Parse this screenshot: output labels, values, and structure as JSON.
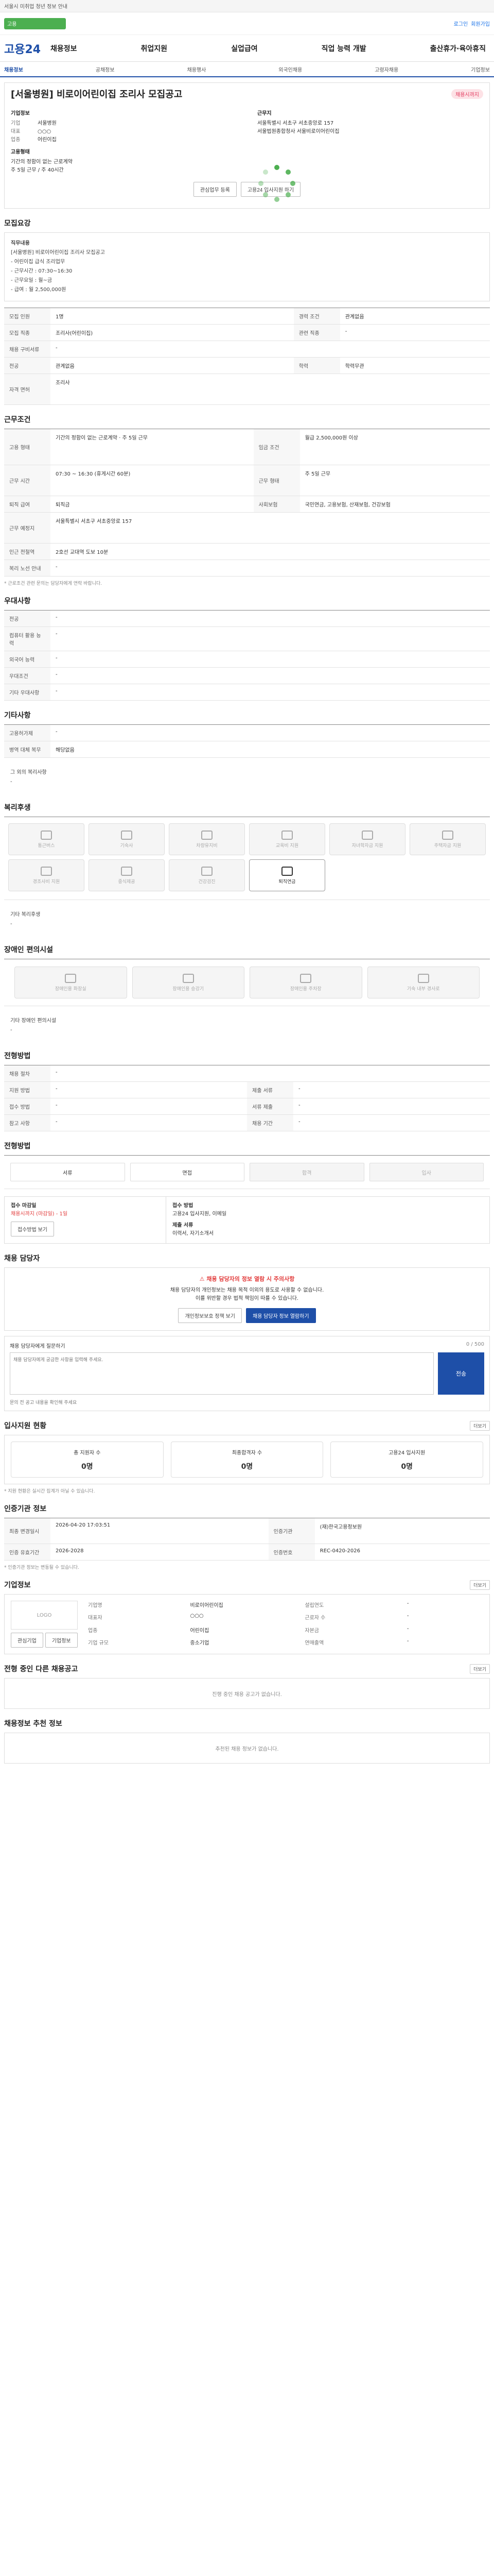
{
  "topbar": {
    "notice": "서울시 미취업 청년 정보 안내"
  },
  "gnb_top": {
    "badge": "고용",
    "links": [
      "로그인",
      "회원가입"
    ]
  },
  "logo": "고용24",
  "menu": [
    "채용정보",
    "취업지원",
    "실업급여",
    "직업 능력 개발",
    "출산휴가·육아휴직"
  ],
  "lnb": [
    "채용정보",
    "공채정보",
    "채용행사",
    "외국인채용",
    "고령자채용",
    "기업정보"
  ],
  "job": {
    "title": "[서울병원] 비로이어린이집 조리사 모집공고",
    "badge": "채용시까지",
    "company_h": "기업정보",
    "company_name": "서울병원",
    "ceo_label": "대표",
    "ceo": "○○○",
    "industry_label": "업종",
    "industry": "어린이집",
    "cond_h": "고용형태",
    "cond1": "기간의 정함이 없는 근로계약",
    "cond2": "주 5일 근무 / 주 40시간",
    "right_h": "근무지",
    "right1": "서울특별시 서초구 서초중앙로 157",
    "right2": "서울법원종합청사 서울비로이어린이집",
    "fav_btn": "관심업무 등록",
    "apply_btn": "고용24 입사지원 하기"
  },
  "recruit": {
    "h": "모집요강",
    "lines": [
      "직무내용",
      "[서울병원] 비로이어린이집 조리사 모집공고",
      "- 어린이집 급식 조리업무",
      "- 근무시간 : 07:30~16:30",
      "- 근무요일 : 월~금",
      "- 급여 : 월 2,500,000원"
    ],
    "table": [
      [
        "모집 인원",
        "1명",
        "경력 조건",
        "관계없음"
      ],
      [
        "모집 직종",
        "조리사(어린이집)",
        "관련 직종",
        "-"
      ],
      [
        "채용 구비서류",
        "-",
        "",
        ""
      ],
      [
        "전공",
        "관계없음",
        "학력",
        "학력무관"
      ],
      [
        "자격 면허",
        "조리사",
        "",
        ""
      ]
    ]
  },
  "work": {
    "h": "근무조건",
    "table": [
      [
        "고용 형태",
        "기간의 정함이 없는 근로계약 · 주 5일 근무",
        "임금 조건",
        "월급 2,500,000원 이상"
      ],
      [
        "근무 시간",
        "07:30 ~ 16:30 (휴게시간 60분)",
        "근무 형태",
        "주 5일 근무"
      ],
      [
        "퇴직 급여",
        "퇴직금",
        "사회보험",
        "국민연금, 고용보험, 산재보험, 건강보험"
      ],
      [
        "근무 예정지",
        "서울특별시 서초구 서초중앙로 157",
        "",
        ""
      ],
      [
        "인근 전철역",
        "2호선 교대역 도보 10분",
        "",
        ""
      ],
      [
        "복리 노선 안내",
        "-",
        "",
        ""
      ]
    ],
    "note": "* 근로조건 관련 문의는 담당자에게 연락 바랍니다."
  },
  "other": {
    "h": "우대사항",
    "rows": [
      [
        "전공",
        "-"
      ],
      [
        "컴퓨터 활용 능력",
        "-"
      ],
      [
        "외국어 능력",
        "-"
      ],
      [
        "우대조건",
        "-"
      ],
      [
        "기타 우대사항",
        "-"
      ]
    ]
  },
  "etc": {
    "h": "기타사항",
    "rows": [
      [
        "고용허가제",
        "-"
      ],
      [
        "병역 대체 복무",
        "해당없음"
      ]
    ],
    "extra_h": "그 외의 복리사항",
    "extra": "-"
  },
  "welfare": {
    "h": "복리후생",
    "items": [
      {
        "l": "통근버스",
        "on": false
      },
      {
        "l": "기숙사",
        "on": false
      },
      {
        "l": "차량유지비",
        "on": false
      },
      {
        "l": "교육비 지원",
        "on": false
      },
      {
        "l": "자녀학자금 지원",
        "on": false
      },
      {
        "l": "주택자금 지원",
        "on": false
      },
      {
        "l": "경조사비 지원",
        "on": false
      },
      {
        "l": "중식제공",
        "on": false
      },
      {
        "l": "건강검진",
        "on": false
      },
      {
        "l": "퇴직연금",
        "on": true
      }
    ],
    "extra_h": "기타 복리후생",
    "extra": "-"
  },
  "disability": {
    "h": "장애인 편의시설",
    "items": [
      "장애인용 화장실",
      "장애인용 승강기",
      "장애인용 주차장",
      "기숙 내부 경사로"
    ],
    "extra_h": "기타 장애인 편의시설",
    "extra": "-"
  },
  "apply": {
    "h": "전형방법",
    "rows": [
      [
        "채용 절차",
        "-",
        "",
        ""
      ],
      [
        "지원 방법",
        "-",
        "제출 서류",
        "-"
      ],
      [
        "접수 방법",
        "-",
        "서류 제출",
        "-"
      ],
      [
        "참고 사항",
        "-",
        "채용 기간",
        "-"
      ]
    ]
  },
  "process": {
    "h": "전형방법",
    "steps": [
      "서류",
      "면접",
      "합격",
      "입사"
    ],
    "dis": [
      false,
      false,
      true,
      true
    ]
  },
  "receipt": {
    "left1": "접수 마감일",
    "left2": "채용시까지 (마감일) - 1일",
    "left_btn": "접수방법 보기",
    "right1": "접수 방법",
    "right2": "고용24 입사지원, 이메일",
    "right3": "제출 서류",
    "right4": "이력서, 자기소개서"
  },
  "manager": {
    "h": "채용 담당자",
    "t": "채용 담당자의 정보 열람 시 주의사항",
    "d1": "채용 담당자의 개인정보는 채용 목적 이외의 용도로 사용할 수 없습니다.",
    "d2": "이를 위반할 경우 법적 책임이 따를 수 있습니다.",
    "btn1": "개인정보보호 정책 보기",
    "btn2": "채용 담당자 정보 열람하기"
  },
  "question": {
    "label": "채용 담당자에게 질문하기",
    "count": "0 / 500",
    "placeholder": "채용 담당자에게 궁금한 사항을 입력해 주세요.",
    "btn": "전송",
    "tip": "문의 전 공고 내용을 확인해 주세요"
  },
  "status": {
    "h": "입사지원 현황",
    "more": "더보기",
    "items": [
      {
        "l": "총 지원자 수",
        "v": "0명"
      },
      {
        "l": "최종합격자 수",
        "v": "0명"
      },
      {
        "l": "고용24 입사지원",
        "v": "0명"
      }
    ],
    "note": "* 지원 현황은 실시간 집계가 아닐 수 있습니다."
  },
  "info": {
    "h": "인증기관 정보",
    "table": [
      [
        "최종 변경일시",
        "2026-04-20 17:03:51",
        "인증기관",
        "(재)한국고용정보원"
      ],
      [
        "인증 유효기간",
        "2026-2028",
        "인증번호",
        "REC-0420-2026"
      ]
    ],
    "note": "* 인증기관 정보는 변동될 수 있습니다."
  },
  "company": {
    "h": "기업정보",
    "more": "더보기",
    "logo": "LOGO",
    "rows": [
      [
        "기업명",
        "비로이어린이집",
        "설립연도",
        "-"
      ],
      [
        "대표자",
        "○○○",
        "근로자 수",
        "-"
      ],
      [
        "업종",
        "어린이집",
        "자본금",
        "-"
      ],
      [
        "기업 규모",
        "중소기업",
        "연매출액",
        "-"
      ]
    ],
    "btn1": "관심기업",
    "btn2": "기업정보"
  },
  "other_jobs": {
    "h": "전형 중인 다른 채용공고",
    "more": "더보기",
    "empty": "진행 중인 채용 공고가 없습니다."
  },
  "recommend": {
    "h": "채용정보 추천 정보",
    "empty": "추천된 채용 정보가 없습니다."
  }
}
